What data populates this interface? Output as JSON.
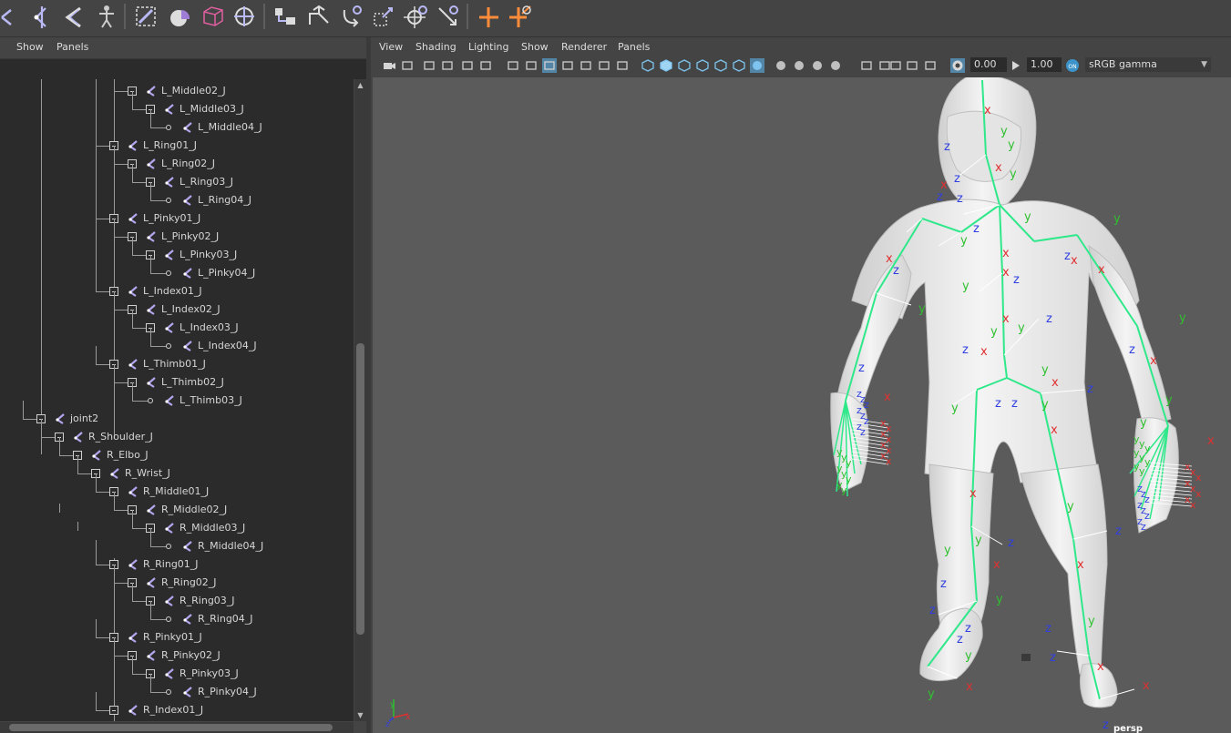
{
  "shelf": {
    "icons": [
      "joint-tool-icon",
      "ik-handle-icon",
      "ik-spline-icon",
      "humanik-icon",
      "smooth-bind-icon",
      "paint-weights-icon",
      "lattice-icon",
      "cluster-icon",
      "orient-joint-icon",
      "mirror-joint-icon",
      "parent-constraint-icon",
      "point-constraint-icon",
      "orient-constraint-icon",
      "aim-constraint-icon",
      "pole-vector-icon",
      "scale-constraint-icon"
    ]
  },
  "outliner": {
    "menu": [
      "Show",
      "Panels"
    ],
    "tree": [
      {
        "label": "L_Middle02_J",
        "depth": 6
      },
      {
        "label": "L_Middle03_J",
        "depth": 7
      },
      {
        "label": "L_Middle04_J",
        "depth": 8,
        "leaf": true
      },
      {
        "label": "L_Ring01_J",
        "depth": 5
      },
      {
        "label": "L_Ring02_J",
        "depth": 6
      },
      {
        "label": "L_Ring03_J",
        "depth": 7
      },
      {
        "label": "L_Ring04_J",
        "depth": 8,
        "leaf": true
      },
      {
        "label": "L_Pinky01_J",
        "depth": 5
      },
      {
        "label": "L_Pinky02_J",
        "depth": 6
      },
      {
        "label": "L_Pinky03_J",
        "depth": 7
      },
      {
        "label": "L_Pinky04_J",
        "depth": 8,
        "leaf": true
      },
      {
        "label": "L_Index01_J",
        "depth": 5
      },
      {
        "label": "L_Index02_J",
        "depth": 6
      },
      {
        "label": "L_Index03_J",
        "depth": 7
      },
      {
        "label": "L_Index04_J",
        "depth": 8,
        "leaf": true
      },
      {
        "label": "L_Thimb01_J",
        "depth": 5
      },
      {
        "label": "L_Thimb02_J",
        "depth": 6
      },
      {
        "label": "L_Thimb03_J",
        "depth": 7,
        "leaf": true
      },
      {
        "label": "joint2",
        "depth": 1
      },
      {
        "label": "R_Shoulder_J",
        "depth": 2
      },
      {
        "label": "R_Elbo_J",
        "depth": 3
      },
      {
        "label": "R_Wrist_J",
        "depth": 4
      },
      {
        "label": "R_Middle01_J",
        "depth": 5
      },
      {
        "label": "R_Middle02_J",
        "depth": 6
      },
      {
        "label": "R_Middle03_J",
        "depth": 7
      },
      {
        "label": "R_Middle04_J",
        "depth": 8,
        "leaf": true
      },
      {
        "label": "R_Ring01_J",
        "depth": 5
      },
      {
        "label": "R_Ring02_J",
        "depth": 6
      },
      {
        "label": "R_Ring03_J",
        "depth": 7
      },
      {
        "label": "R_Ring04_J",
        "depth": 8,
        "leaf": true
      },
      {
        "label": "R_Pinky01_J",
        "depth": 5
      },
      {
        "label": "R_Pinky02_J",
        "depth": 6
      },
      {
        "label": "R_Pinky03_J",
        "depth": 7
      },
      {
        "label": "R_Pinky04_J",
        "depth": 8,
        "leaf": true
      },
      {
        "label": "R_Index01_J",
        "depth": 5
      }
    ]
  },
  "viewport": {
    "menu": [
      "View",
      "Shading",
      "Lighting",
      "Show",
      "Renderer",
      "Panels"
    ],
    "exposure": "0.00",
    "gamma": "1.00",
    "color_space": "sRGB gamma",
    "camera_label": "persp",
    "axis_labels": {
      "x": "x",
      "y": "y",
      "z": "z"
    },
    "colors": {
      "joint": "#2fe88a",
      "x_axis": "#e03030",
      "y_axis": "#30c030",
      "z_axis": "#3040e0",
      "mesh": "#e9e9e9",
      "background": "#5b5b5b"
    }
  }
}
